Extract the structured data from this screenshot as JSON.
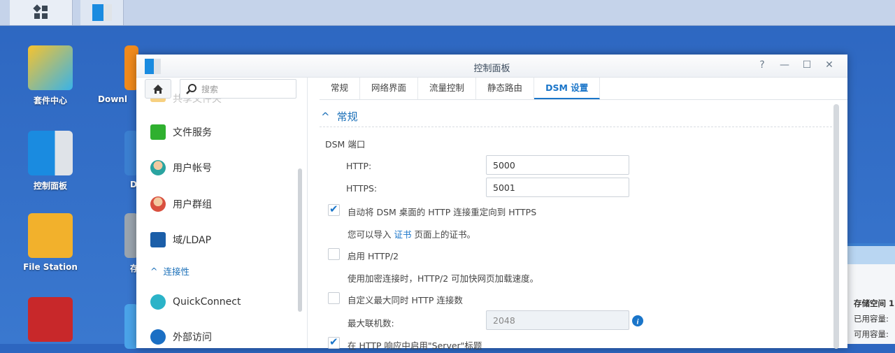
{
  "taskbar": {
    "main_menu": "main-menu",
    "open_app": "control-panel"
  },
  "desktop": {
    "icons": [
      {
        "label": "套件中心"
      },
      {
        "label": "Downl"
      },
      {
        "label": "控制面板"
      },
      {
        "label": "D"
      },
      {
        "label": "File Station"
      },
      {
        "label": "存"
      }
    ]
  },
  "window": {
    "title": "控制面板",
    "controls": {
      "help": "?",
      "minimize": "—",
      "maximize": "☐",
      "close": "✕"
    }
  },
  "sidebar": {
    "search_placeholder": "搜索",
    "items": [
      {
        "label": "共享文件夹"
      },
      {
        "label": "文件服务"
      },
      {
        "label": "用户帐号"
      },
      {
        "label": "用户群组"
      },
      {
        "label": "域/LDAP"
      }
    ],
    "group": "连接性",
    "items2": [
      {
        "label": "QuickConnect"
      },
      {
        "label": "外部访问"
      }
    ]
  },
  "tabs": [
    "常规",
    "网络界面",
    "流量控制",
    "静态路由",
    "DSM 设置"
  ],
  "main": {
    "section": "常规",
    "port_label": "DSM 端口",
    "http_label": "HTTP:",
    "http_value": "5000",
    "https_label": "HTTPS:",
    "https_value": "5001",
    "redirect": "自动将 DSM 桌面的 HTTP 连接重定向到 HTTPS",
    "import_pre": "您可以导入",
    "import_link": "证书",
    "import_post": "页面上的证书。",
    "http2": "启用 HTTP/2",
    "http2_desc": "使用加密连接时，HTTP/2 可加快网页加载速度。",
    "custom_max": "自定义最大同时 HTTP 连接数",
    "max_label": "最大联机数:",
    "max_value": "2048",
    "server_header": "在 HTTP 响应中启用\"Server\"标题"
  },
  "widget": {
    "lines": [
      "存储空间 1",
      "已用容量:",
      "可用容量:"
    ]
  },
  "colors": {
    "accent": "#1a75c9",
    "desktop": "#2f6bc2"
  }
}
